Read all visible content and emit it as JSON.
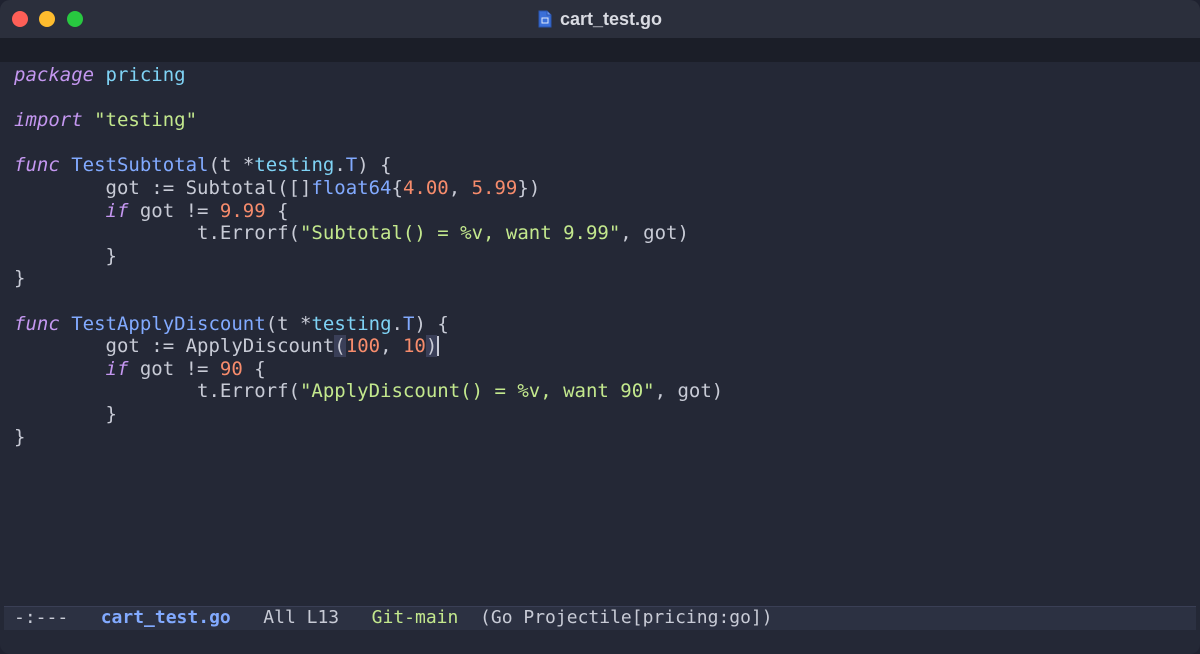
{
  "window": {
    "title": "cart_test.go"
  },
  "editor": {
    "lines": [
      {
        "tokens": [
          {
            "t": "package",
            "c": "kw"
          },
          {
            "t": " ",
            "c": "plain"
          },
          {
            "t": "pricing",
            "c": "pkg"
          }
        ]
      },
      {
        "tokens": []
      },
      {
        "tokens": [
          {
            "t": "import",
            "c": "kw"
          },
          {
            "t": " ",
            "c": "plain"
          },
          {
            "t": "\"testing\"",
            "c": "str"
          }
        ]
      },
      {
        "tokens": []
      },
      {
        "tokens": [
          {
            "t": "func",
            "c": "kw"
          },
          {
            "t": " ",
            "c": "plain"
          },
          {
            "t": "TestSubtotal",
            "c": "fn"
          },
          {
            "t": "(t *",
            "c": "plain"
          },
          {
            "t": "testing",
            "c": "pkg"
          },
          {
            "t": ".",
            "c": "plain"
          },
          {
            "t": "T",
            "c": "ty"
          },
          {
            "t": ") {",
            "c": "plain"
          }
        ]
      },
      {
        "tokens": [
          {
            "t": "        got := Subtotal([]",
            "c": "plain"
          },
          {
            "t": "float64",
            "c": "ty"
          },
          {
            "t": "{",
            "c": "plain"
          },
          {
            "t": "4.00",
            "c": "num"
          },
          {
            "t": ", ",
            "c": "plain"
          },
          {
            "t": "5.99",
            "c": "num"
          },
          {
            "t": "})",
            "c": "plain"
          }
        ]
      },
      {
        "tokens": [
          {
            "t": "        ",
            "c": "plain"
          },
          {
            "t": "if",
            "c": "kw"
          },
          {
            "t": " got != ",
            "c": "plain"
          },
          {
            "t": "9.99",
            "c": "num"
          },
          {
            "t": " {",
            "c": "plain"
          }
        ]
      },
      {
        "tokens": [
          {
            "t": "                t.Errorf(",
            "c": "plain"
          },
          {
            "t": "\"Subtotal() = %v, want 9.99\"",
            "c": "str"
          },
          {
            "t": ", got)",
            "c": "plain"
          }
        ]
      },
      {
        "tokens": [
          {
            "t": "        }",
            "c": "plain"
          }
        ]
      },
      {
        "tokens": [
          {
            "t": "}",
            "c": "plain"
          }
        ]
      },
      {
        "tokens": []
      },
      {
        "tokens": [
          {
            "t": "func",
            "c": "kw"
          },
          {
            "t": " ",
            "c": "plain"
          },
          {
            "t": "TestApplyDiscount",
            "c": "fn"
          },
          {
            "t": "(t *",
            "c": "plain"
          },
          {
            "t": "testing",
            "c": "pkg"
          },
          {
            "t": ".",
            "c": "plain"
          },
          {
            "t": "T",
            "c": "ty"
          },
          {
            "t": ") {",
            "c": "plain"
          }
        ]
      },
      {
        "tokens": [
          {
            "t": "        got := ApplyDiscount",
            "c": "plain"
          },
          {
            "t": "(",
            "c": "paren-hl"
          },
          {
            "t": "100",
            "c": "num"
          },
          {
            "t": ", ",
            "c": "plain"
          },
          {
            "t": "10",
            "c": "num"
          },
          {
            "t": ")",
            "c": "paren-hl"
          },
          {
            "t": "",
            "c": "cursor"
          }
        ]
      },
      {
        "tokens": [
          {
            "t": "        ",
            "c": "plain"
          },
          {
            "t": "if",
            "c": "kw"
          },
          {
            "t": " got != ",
            "c": "plain"
          },
          {
            "t": "90",
            "c": "num"
          },
          {
            "t": " {",
            "c": "plain"
          }
        ]
      },
      {
        "tokens": [
          {
            "t": "                t.Errorf(",
            "c": "plain"
          },
          {
            "t": "\"ApplyDiscount() = %v, want 90\"",
            "c": "str"
          },
          {
            "t": ", got)",
            "c": "plain"
          }
        ]
      },
      {
        "tokens": [
          {
            "t": "        }",
            "c": "plain"
          }
        ]
      },
      {
        "tokens": [
          {
            "t": "}",
            "c": "plain"
          }
        ]
      }
    ]
  },
  "modeline": {
    "status": "-:---",
    "buffer": "cart_test.go",
    "position": "All L13",
    "vc": "Git-main",
    "modes": "(Go Projectile[pricing:go])"
  },
  "colors": {
    "keyword": "#c497f0",
    "function": "#82aaff",
    "string": "#c3e88d",
    "number": "#f78c6c",
    "package": "#7fd3f5",
    "background": "#242836"
  },
  "icons": {
    "file": "go-file-icon"
  }
}
